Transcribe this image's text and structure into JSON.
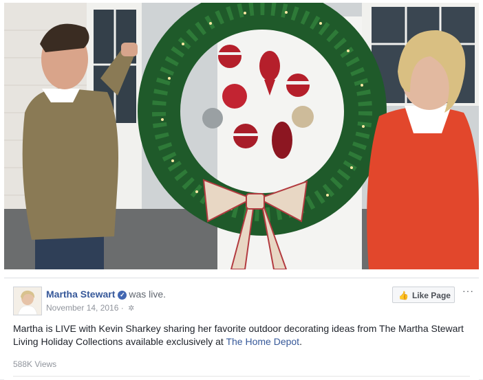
{
  "post": {
    "page_name": "Martha Stewart",
    "status": "was live.",
    "date": "November 14, 2016 · ",
    "body_text": "Martha is LIVE with Kevin Sharkey sharing her favorite outdoor decorating ideas from The Martha Stewart Living Holiday Collections available exclusively at ",
    "body_link": "The Home Depot",
    "body_end": ".",
    "views": "588K Views",
    "like_button": "Like Page",
    "more_menu": "···"
  },
  "icons": {
    "verified": "verified-badge-icon",
    "globe": "globe-icon",
    "like": "thumbs-up-icon"
  },
  "colors": {
    "link": "#365899",
    "verified": "#4267b2",
    "wreath": "#1f5a2a",
    "ornament_red": "#b51f2b"
  }
}
